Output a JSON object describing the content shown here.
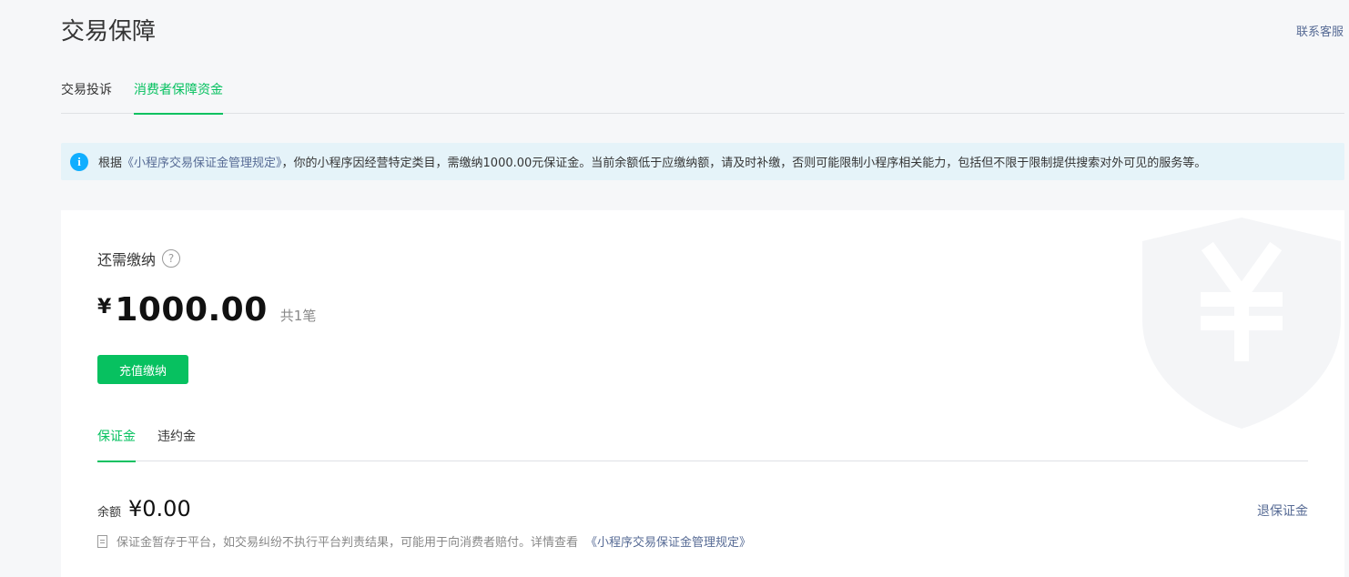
{
  "page": {
    "title": "交易保障",
    "contact_label": "联系客服"
  },
  "tabs": [
    {
      "label": "交易投诉",
      "active": false
    },
    {
      "label": "消费者保障资金",
      "active": true
    }
  ],
  "notice": {
    "icon": "info-icon",
    "prefix": "根据",
    "link_text": "《小程序交易保证金管理规定》",
    "body": "，你的小程序因经营特定类目，需缴纳1000.00元保证金。当前余额低于应缴纳额，请及时补缴，否则可能限制小程序相关能力，包括但不限于限制提供搜索对外可见的服务等。"
  },
  "summary": {
    "due_label": "还需缴纳",
    "help_icon": "question-icon",
    "currency": "¥",
    "amount": "1000.00",
    "count": "共1笔",
    "pay_button": "充值缴纳"
  },
  "subtabs": [
    {
      "label": "保证金",
      "active": true
    },
    {
      "label": "违约金",
      "active": false
    }
  ],
  "balance": {
    "label": "余额",
    "value": "¥0.00",
    "refund_label": "退保证金",
    "desc": "保证金暂存于平台，如交易纠纷不执行平台判责结果，可能用于向消费者赔付。详情查看",
    "desc_link": "《小程序交易保证金管理规定》"
  },
  "colors": {
    "accent": "#07c160",
    "link": "#576b95",
    "notice_bg": "#e5f3f9",
    "info_icon": "#10aeff"
  }
}
